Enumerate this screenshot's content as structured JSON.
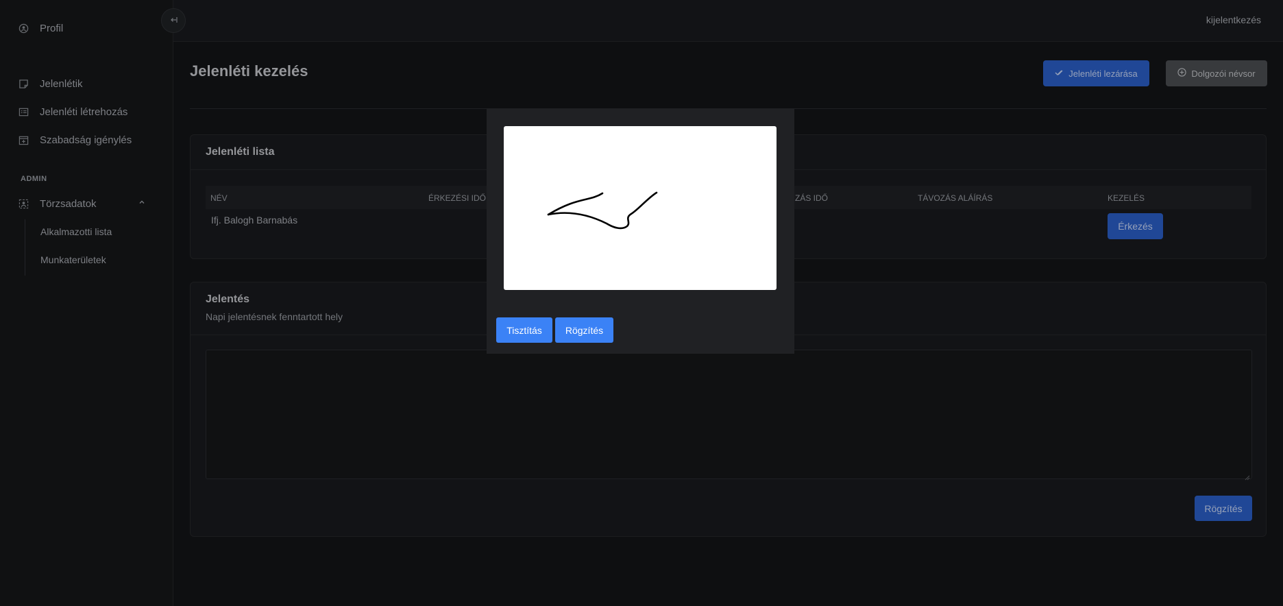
{
  "sidebar": {
    "profile": "Profil",
    "items": [
      {
        "label": "Jelenlétik",
        "icon": "sheet-icon"
      },
      {
        "label": "Jelenléti létrehozás",
        "icon": "list-icon"
      },
      {
        "label": "Szabadság igénylés",
        "icon": "calendar-plus-icon"
      }
    ],
    "admin_label": "ADMIN",
    "master_data": "Törzsadatok",
    "sub_items": [
      "Alkalmazotti lista",
      "Munkaterületek"
    ]
  },
  "topbar": {
    "logout": "kijelentkezés"
  },
  "page": {
    "title": "Jelenléti kezelés",
    "close_button": "Jelenléti lezárása",
    "roster_button": "Dolgozói névsor"
  },
  "attendance": {
    "title": "Jelenléti lista",
    "columns": [
      "NÉV",
      "ÉRKEZÉSI IDŐ",
      "ZÁS IDŐ",
      "TÁVOZÁS ALÁÍRÁS",
      "KEZELÉS"
    ],
    "rows": [
      {
        "name": "Ifj. Balogh Barnabás",
        "action": "Érkezés"
      }
    ]
  },
  "report": {
    "title": "Jelentés",
    "subtitle": "Napi jelentésnek fenntartott hely",
    "textarea_value": "",
    "save": "Rögzítés"
  },
  "signature_modal": {
    "clear": "Tisztítás",
    "save": "Rögzítés"
  },
  "colors": {
    "primary": "#2857b8",
    "modal_primary": "#3b82f6",
    "background": "#121315"
  }
}
